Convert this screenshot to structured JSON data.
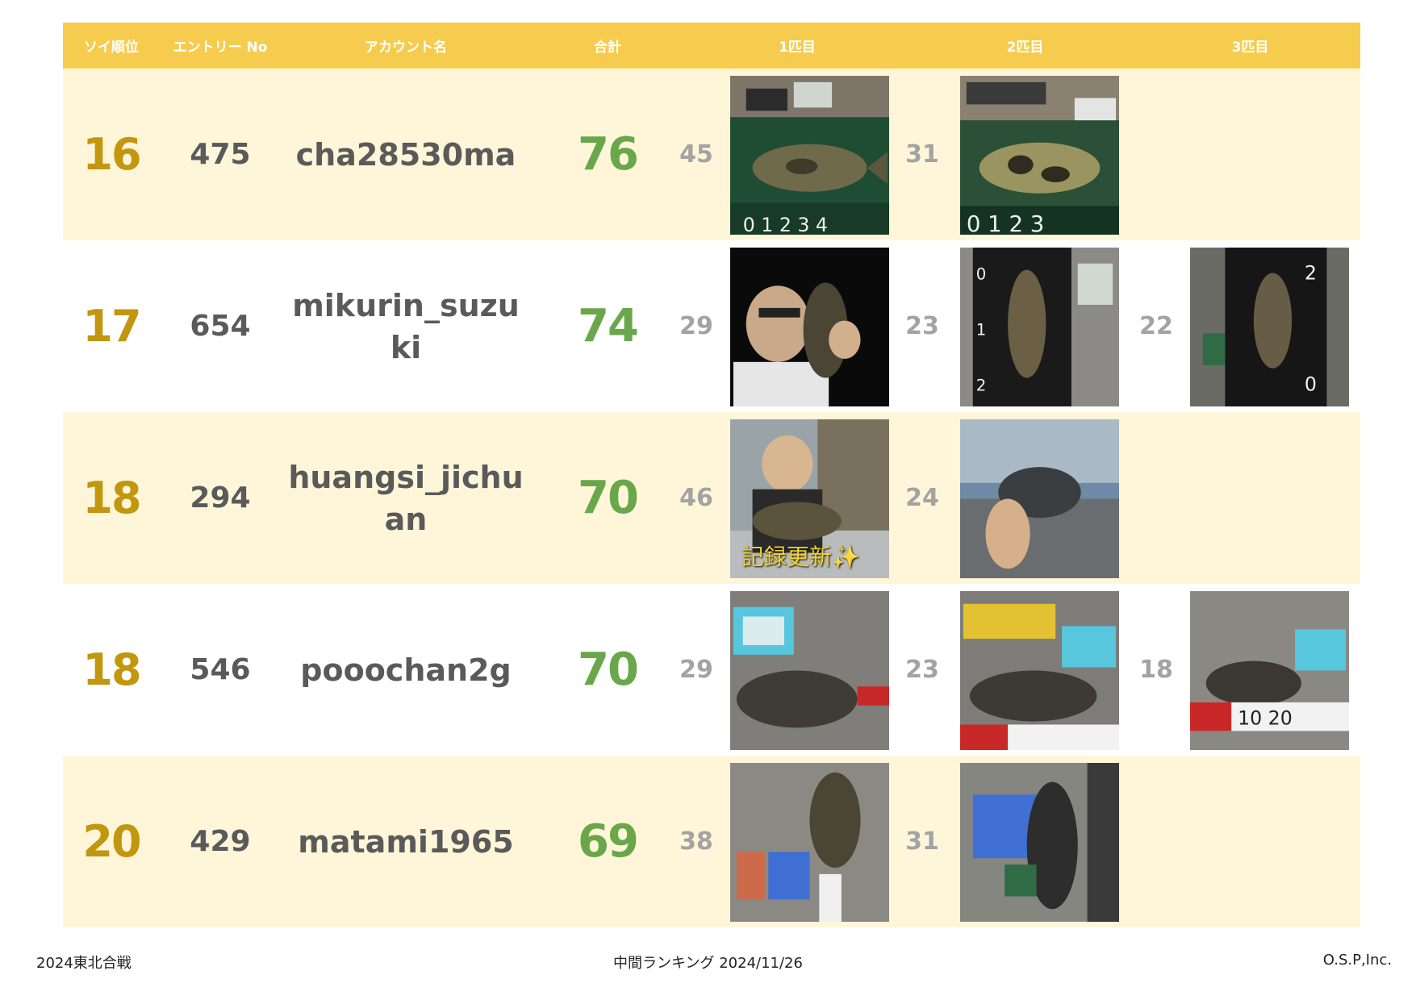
{
  "header": {
    "rank": "ソイ順位",
    "entry_no": "エントリー No",
    "account": "アカウント名",
    "total": "合計",
    "fish1": "1匹目",
    "fish2": "2匹目",
    "fish3": "3匹目"
  },
  "rows": [
    {
      "rank": "16",
      "entry": "475",
      "account": "cha28530ma",
      "total": "76",
      "fish": [
        {
          "score": "45",
          "photo": "fish-on-measure-board"
        },
        {
          "score": "31",
          "photo": "fish-on-measure-board"
        },
        {
          "score": "",
          "photo": ""
        }
      ]
    },
    {
      "rank": "17",
      "entry": "654",
      "account": "mikurin_suzuki",
      "total": "74",
      "fish": [
        {
          "score": "29",
          "photo": "angler-holding-fish-night"
        },
        {
          "score": "23",
          "photo": "fish-on-measure-board"
        },
        {
          "score": "22",
          "photo": "fish-on-measure-board"
        }
      ]
    },
    {
      "rank": "18",
      "entry": "294",
      "account": "huangsi_jichuan",
      "total": "70",
      "fish": [
        {
          "score": "46",
          "photo": "angler-holding-fish",
          "overlay": "記録更新✨"
        },
        {
          "score": "24",
          "photo": "hand-holding-fish"
        },
        {
          "score": "",
          "photo": ""
        }
      ]
    },
    {
      "rank": "18",
      "entry": "546",
      "account": "pooochan2g",
      "total": "70",
      "fish": [
        {
          "score": "29",
          "photo": "fish-on-ground-with-tag"
        },
        {
          "score": "23",
          "photo": "fish-with-lure-pack"
        },
        {
          "score": "18",
          "photo": "fish-on-measure-tape"
        }
      ]
    },
    {
      "rank": "20",
      "entry": "429",
      "account": "matami1965",
      "total": "69",
      "fish": [
        {
          "score": "38",
          "photo": "fish-on-ground-with-tag"
        },
        {
          "score": "31",
          "photo": "fish-with-lure-pack"
        },
        {
          "score": "",
          "photo": ""
        }
      ]
    }
  ],
  "footer": {
    "left": "2024東北合戦",
    "center": "中間ランキング 2024/11/26",
    "right": "O.S.P,Inc."
  },
  "colors": {
    "header_bg": "#f6cc4f",
    "row_shade": "#fff6d9",
    "rank": "#c2960e",
    "total": "#6aa74a",
    "score": "#a3a3a3",
    "text": "#5a5a5a"
  }
}
